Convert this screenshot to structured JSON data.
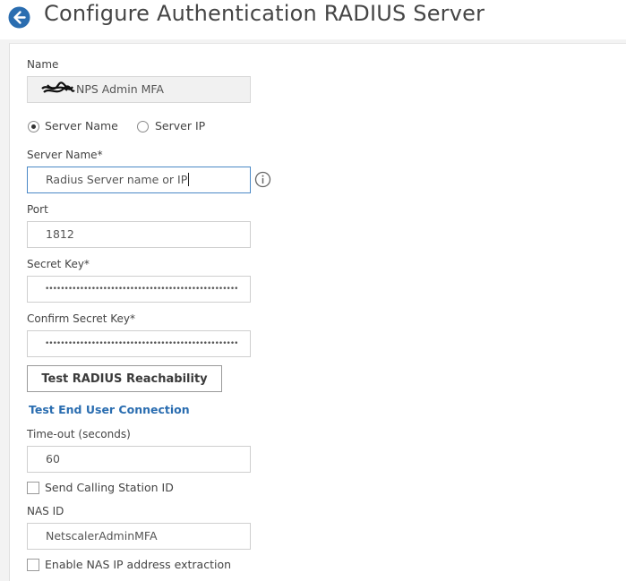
{
  "header": {
    "title": "Configure Authentication RADIUS Server",
    "back_icon": "arrow-left-circle-icon",
    "accent_color": "#2a6db0"
  },
  "form": {
    "name": {
      "label": "Name",
      "value": "NPS Admin MFA"
    },
    "server_type": {
      "options": [
        {
          "label": "Server Name",
          "selected": true
        },
        {
          "label": "Server IP",
          "selected": false
        }
      ]
    },
    "server_name": {
      "label": "Server Name*",
      "value": "Radius Server name or IP",
      "info_icon": "info-circle-icon"
    },
    "port": {
      "label": "Port",
      "value": "1812"
    },
    "secret_key": {
      "label": "Secret Key*",
      "value": "••••••••••••••••••••••••••••••••••••••••••••••••••"
    },
    "confirm_secret_key": {
      "label": "Confirm Secret Key*",
      "value": "••••••••••••••••••••••••••••••••••••••••••••••••••"
    },
    "test_button": {
      "label": "Test RADIUS Reachability"
    },
    "test_link": {
      "label": "Test End User Connection"
    },
    "timeout": {
      "label": "Time-out (seconds)",
      "value": "60"
    },
    "send_calling_station": {
      "label": "Send Calling Station ID",
      "checked": false
    },
    "nas_id": {
      "label": "NAS ID",
      "value": "NetscalerAdminMFA"
    },
    "nas_ip_extraction": {
      "label": "Enable NAS IP address extraction",
      "checked": false
    }
  }
}
